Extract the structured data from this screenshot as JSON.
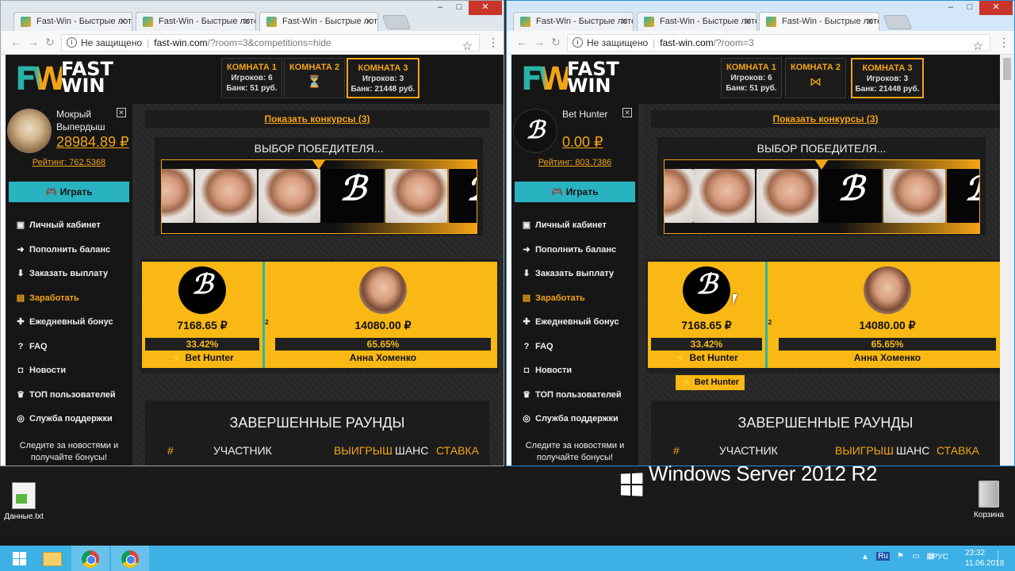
{
  "browser_tab_title": "Fast-Win - Быстрые лоте",
  "tab_close": "✕",
  "left_window": {
    "url_warning": "Не защищено",
    "url_host": "fast-win.com",
    "url_path": "/?room=3&competitions=hide",
    "user": {
      "name": "Мокрый Выпердыш",
      "balance": "28984.89 ₽",
      "rating": "Рейтинг: 762.5368"
    },
    "room2_icon": "hourglass-icon"
  },
  "right_window": {
    "url_warning": "Не защищено",
    "url_host": "fast-win.com",
    "url_path": "/?room=3",
    "user": {
      "name": "Bet Hunter",
      "balance": "0.00 ₽",
      "rating": "Рейтинг: 803.7386"
    },
    "room2_icon": "bowtie-icon",
    "tooltip": "⚡ Bet Hunter"
  },
  "logo_text": "FAST WIN",
  "logo_mark": "FW",
  "rooms": [
    {
      "title": "КОМНАТА 1",
      "players": "Игроков: 6",
      "bank": "Банк: 51 руб."
    },
    {
      "title": "КОМНАТА 2"
    },
    {
      "title": "КОМНАТА 3",
      "players": "Игроков: 3",
      "bank": "Банк: 21448 руб."
    }
  ],
  "play_button": "Играть",
  "nav": [
    {
      "label": "Личный кабинет",
      "icon": "briefcase-icon"
    },
    {
      "label": "Пополнить баланс",
      "icon": "arrow-right-circle-icon"
    },
    {
      "label": "Заказать выплату",
      "icon": "arrow-down-circle-icon"
    },
    {
      "label": "Заработать",
      "icon": "money-icon"
    },
    {
      "label": "Ежедневный бонус",
      "icon": "gift-icon"
    },
    {
      "label": "FAQ",
      "icon": "question-icon"
    },
    {
      "label": "Новости",
      "icon": "bookmark-icon"
    },
    {
      "label": "ТОП пользователей",
      "icon": "trophy-icon"
    },
    {
      "label": "Служба поддержки",
      "icon": "lifebuoy-icon"
    }
  ],
  "news_text": "Следите за новостями и получайте бонусы!",
  "show_contests": "Показать конкурсы (3)",
  "winner_title": "ВЫБОР ПОБЕДИТЕЛЯ...",
  "players": [
    {
      "amount": "7168.65 ₽",
      "chance": "33.42%",
      "name": "⚡ Bet Hunter"
    },
    {
      "amount": "14080.00 ₽",
      "chance": "65.65%",
      "name": "Анна Хоменко"
    }
  ],
  "tiny_player_chance": "2",
  "finished_title": "ЗАВЕРШЕННЫЕ РАУНДЫ",
  "finished_cols": {
    "num": "#",
    "player": "УЧАСТНИК",
    "win": "ВЫИГРЫШ",
    "chance": "ШАНС",
    "bet": "СТАВКА"
  },
  "desktop": {
    "file_label": "Данные.txt",
    "bin_label": "Корзина",
    "os_text": "Windows Server 2012 R2"
  },
  "tray": {
    "lang": "РУС",
    "time": "23:32",
    "date": "11.06.2018",
    "ime": "Ru"
  },
  "colors": {
    "accent": "#f3a416",
    "teal": "#29b3a7",
    "card": "#f9b814",
    "taskbar": "#3db0e6"
  }
}
